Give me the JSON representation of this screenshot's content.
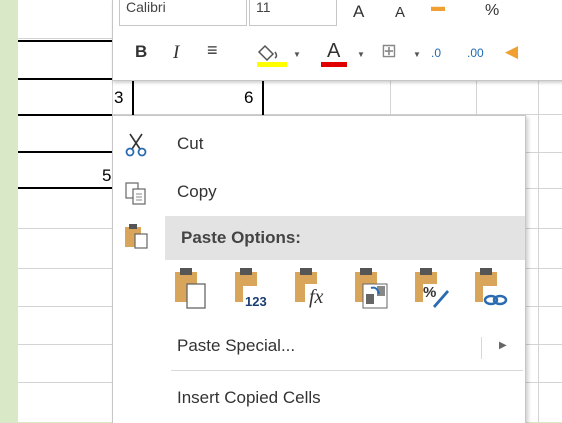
{
  "spreadsheet": {
    "cells": [
      "3",
      "6",
      "5"
    ]
  },
  "mini_toolbar": {
    "font_name": "Calibri",
    "font_size": "11",
    "bold": "B",
    "italic": "I",
    "font_color_letter": "A",
    "fill_color": "#ffff00",
    "font_color": "#e00000",
    "percent": "%",
    "inc_decimal": ".0",
    "dec_decimal": ".00"
  },
  "context_menu": {
    "cut": "Cut",
    "copy": "Copy",
    "paste_options_header": "Paste Options:",
    "paste_icons": [
      "paste-icon",
      "paste-values-icon",
      "paste-formulas-icon",
      "transpose-icon",
      "paste-formatting-icon",
      "paste-link-icon"
    ],
    "paste_icon_labels": [
      "",
      "123",
      "fx",
      "",
      "%",
      ""
    ],
    "paste_special": "Paste Special...",
    "insert_copied_cells": "Insert Copied Cells"
  },
  "colors": {
    "clipboard": "#d9a55a",
    "accent_blue": "#2b6cb0",
    "window_bg": "#d9e8c7"
  }
}
